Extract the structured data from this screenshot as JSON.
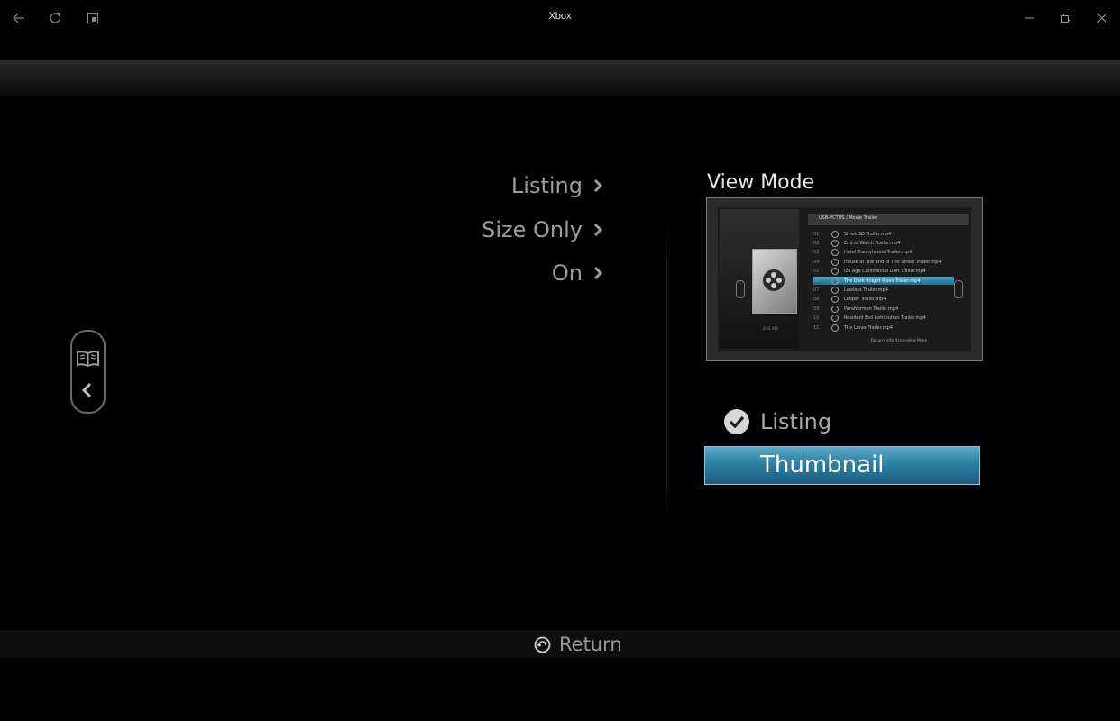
{
  "window": {
    "title": "Xbox"
  },
  "menu": {
    "items": [
      {
        "label": "Listing"
      },
      {
        "label": "Size Only"
      },
      {
        "label": "On"
      }
    ]
  },
  "view_mode": {
    "title": "View Mode",
    "options": [
      {
        "label": "Listing",
        "checked": true
      },
      {
        "label": "Thumbnail",
        "highlighted": true
      }
    ]
  },
  "preview": {
    "header": "USB-PCTUS / Movie Trailer",
    "rows": [
      {
        "n": "01",
        "name": "Shrek 3D Trailer.mp4"
      },
      {
        "n": "02",
        "name": "End of Watch Trailer.mp4"
      },
      {
        "n": "03",
        "name": "Hotel Transylvania Trailer.mp4"
      },
      {
        "n": "04",
        "name": "House at The End of The Street Trailer.mp4"
      },
      {
        "n": "05",
        "name": "Ice Age Continental Drift Trailer.mp4"
      },
      {
        "n": "06",
        "name": "The Dark Knight Rises Trailer.mp4"
      },
      {
        "n": "07",
        "name": "Lawless Trailer.mp4"
      },
      {
        "n": "08",
        "name": "Looper Trailer.mp4"
      },
      {
        "n": "09",
        "name": "ParaNorman Trailer.mp4"
      },
      {
        "n": "10",
        "name": "Resident Evil Retribution Trailer.mp4"
      },
      {
        "n": "11",
        "name": "The Lorax Trailer.mp4"
      }
    ],
    "selected_index": 5,
    "footer": "Return  Info  Ascending  Mark",
    "size": "435 MB"
  },
  "footer": {
    "return_label": "Return"
  },
  "colors": {
    "accent": "#2d7fa2",
    "background": "#000000"
  }
}
